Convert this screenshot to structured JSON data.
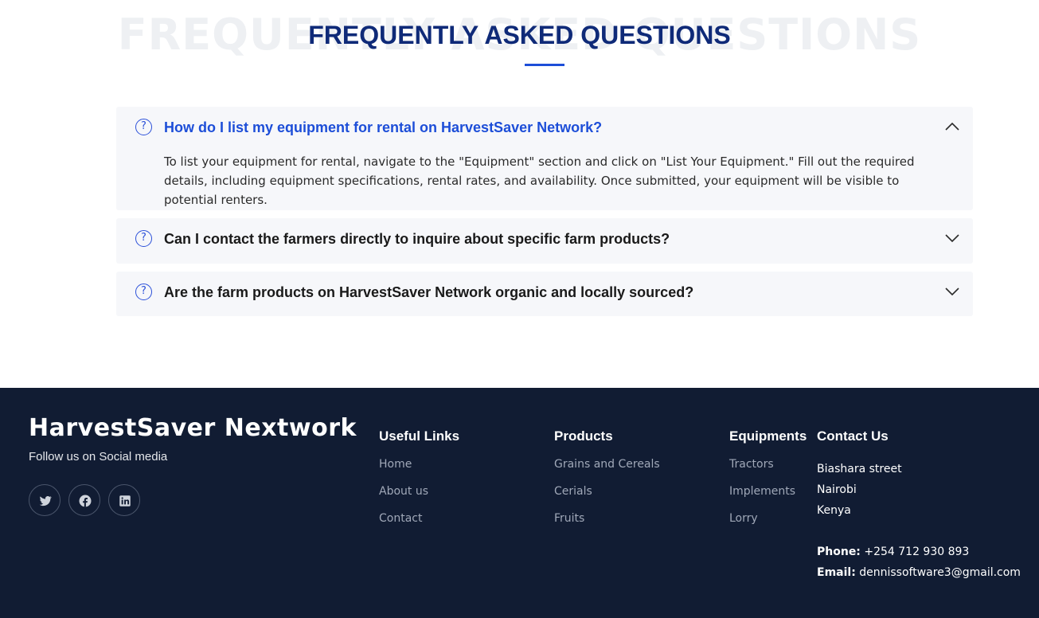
{
  "faq": {
    "background_title": "FREQUENTLY ASKED QUESTIONS",
    "title": "FREQUENTLY ASKED QUESTIONS",
    "items": [
      {
        "question": "How do I list my equipment for rental on HarvestSaver Network?",
        "answer": "To list your equipment for rental, navigate to the \"Equipment\" section and click on \"List Your Equipment.\" Fill out the required details, including equipment specifications, rental rates, and availability. Once submitted, your equipment will be visible to potential renters.",
        "expanded": true
      },
      {
        "question": "Can I contact the farmers directly to inquire about specific farm products?",
        "expanded": false
      },
      {
        "question": "Are the farm products on HarvestSaver Network organic and locally sourced?",
        "expanded": false
      }
    ],
    "question_icon": "?",
    "accent_color": "#1d4ed8",
    "title_color": "#0f2a78"
  },
  "footer": {
    "brand": "HarvestSaver Nextwork",
    "follow_text": "Follow us on Social media",
    "social_icons": [
      "twitter-icon",
      "facebook-icon",
      "linkedin-icon"
    ],
    "useful_links": {
      "title": "Useful Links",
      "links": [
        "Home",
        "About us",
        "Contact"
      ]
    },
    "products": {
      "title": "Products",
      "links": [
        "Grains and Cereals",
        "Cerials",
        "Fruits"
      ]
    },
    "equipments": {
      "title": "Equipments",
      "links": [
        "Tractors",
        "Implements",
        "Lorry"
      ]
    },
    "contact": {
      "title": "Contact Us",
      "address": [
        "Biashara street",
        "Nairobi",
        "Kenya"
      ],
      "phone_label": "Phone:",
      "phone": "+254 712 930 893",
      "email_label": "Email:",
      "email": "dennissoftware3@gmail.com"
    },
    "background_color": "#111c33"
  }
}
